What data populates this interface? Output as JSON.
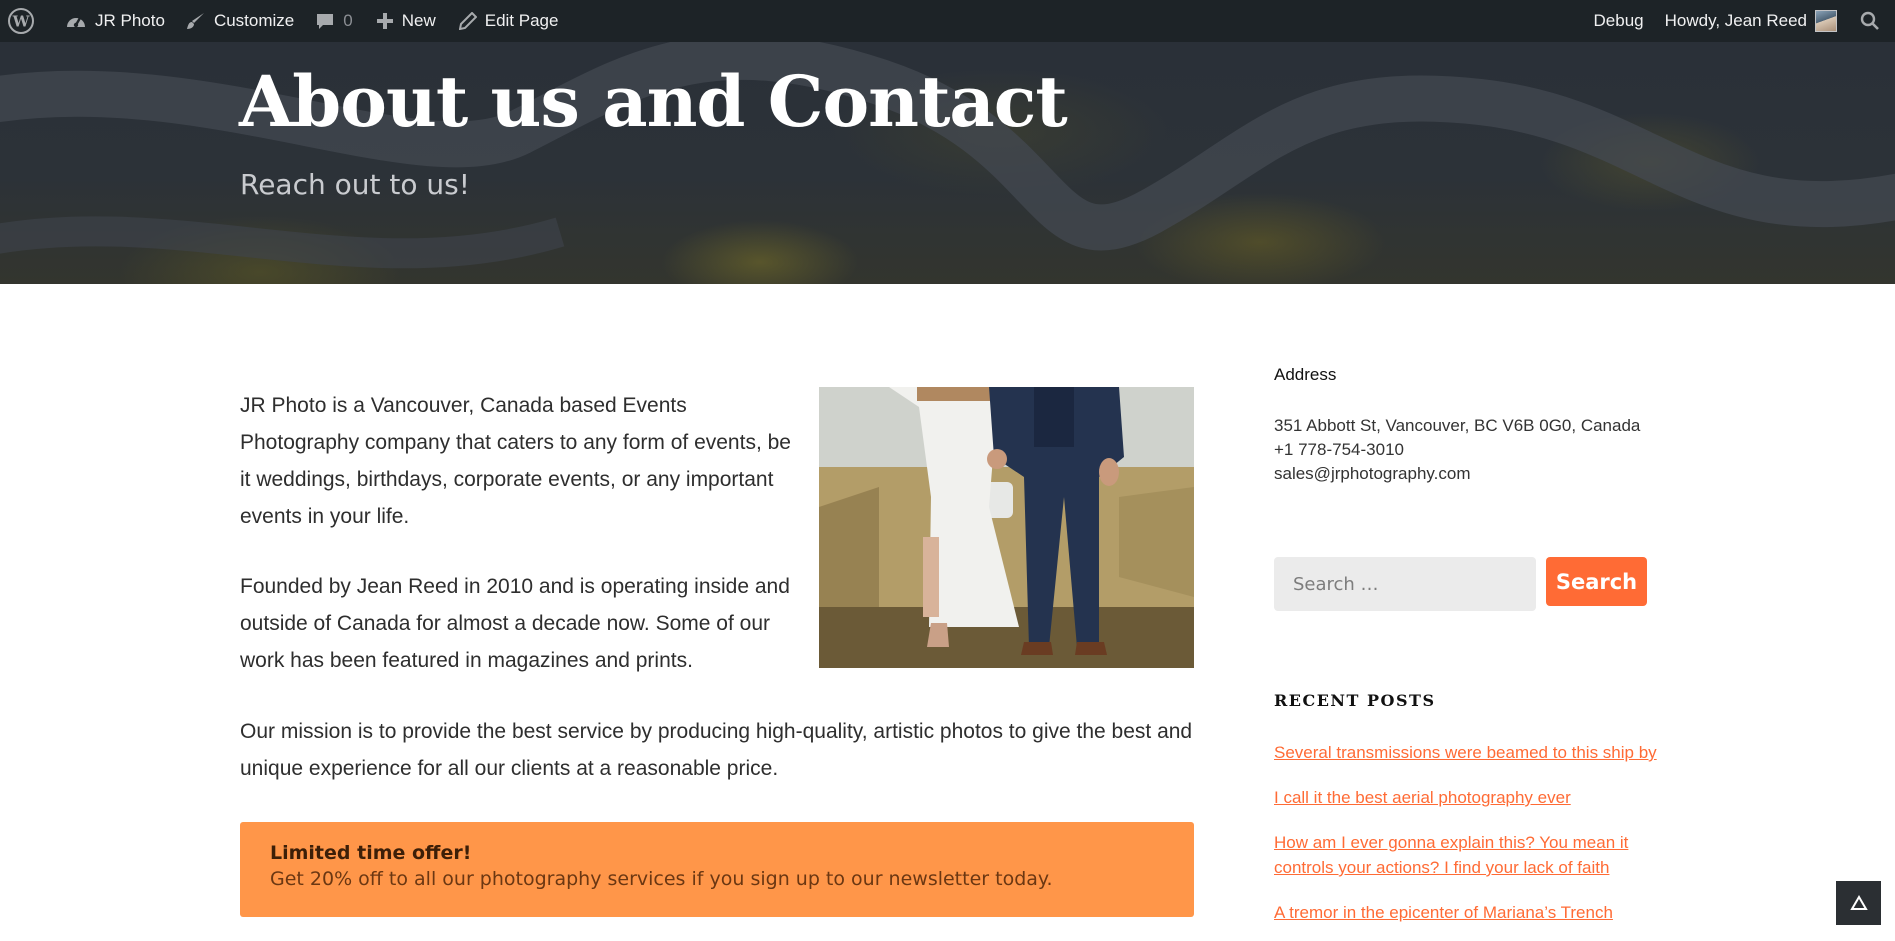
{
  "adminbar": {
    "site_name": "JR Photo",
    "customize": "Customize",
    "comments_count": "0",
    "new_label": "New",
    "edit_page": "Edit Page",
    "debug": "Debug",
    "howdy": "Howdy, Jean Reed"
  },
  "hero": {
    "title": "About us and Contact",
    "tagline": "Reach out to us!"
  },
  "main": {
    "paragraph1": "JR Photo is a Vancouver, Canada based Events Photography company that caters to any form of events, be it weddings, birthdays, corporate events, or any important events in your life.",
    "paragraph2": "Founded by Jean Reed in 2010 and is operating inside and outside of Canada for almost a decade now. Some of our work has been featured in magazines and prints.",
    "paragraph3": "Our mission is to provide the best service by producing high-quality, artistic photos to give the best and unique experience for all our clients at a reasonable price.",
    "offer_title": "Limited time offer!",
    "offer_text": "Get 20% off to all our photography services if you sign up to our newsletter today."
  },
  "sidebar": {
    "address_title": "Address",
    "address_line": "351 Abbott St, Vancouver, BC V6B 0G0, Canada",
    "phone": "+1 778-754-3010",
    "email": "sales@jrphotography.com",
    "search_placeholder": "Search …",
    "search_button": "Search",
    "recent_posts_title": "RECENT POSTS",
    "recent_posts": [
      "Several transmissions were beamed to this ship by",
      "I call it the best aerial photography ever",
      "How am I ever gonna explain this? You mean it controls your actions? I find your lack of faith",
      "A tremor in the epicenter of Mariana’s Trench"
    ]
  },
  "colors": {
    "adminbar_bg": "#1d2327",
    "accent": "#ff6b35",
    "offer_bg": "#ff9649"
  },
  "icons": [
    "wordpress-icon",
    "dashboard-icon",
    "brush-icon",
    "comment-icon",
    "plus-icon",
    "pencil-icon",
    "search-icon",
    "arrow-up-icon"
  ]
}
